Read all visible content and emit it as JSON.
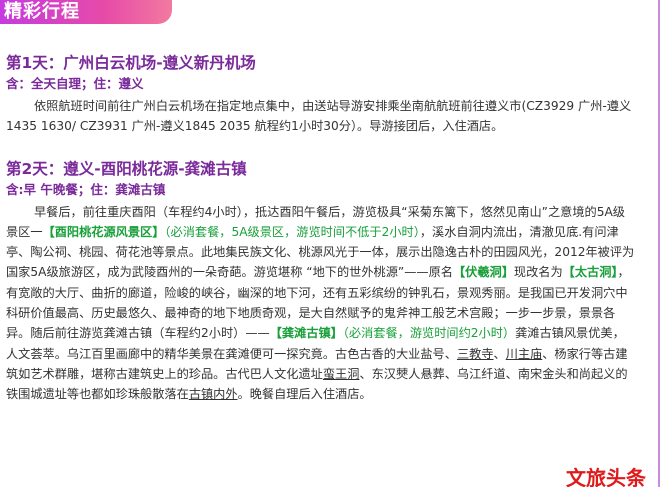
{
  "banner": {
    "title": "精彩行程"
  },
  "day1": {
    "title": "第1天：广州白云机场-遵义新丹机场",
    "meta": "含：全天自理；住：遵义",
    "text": "依照航班时间前往广州白云机场在指定地点集中，由送站导游安排乘坐南航航班前往遵义市(CZ3929 广州-遵义1435 1630/ CZ3931 广州-遵义1845 2035 航程约1小时30分）。导游接团后，入住酒店。"
  },
  "day2": {
    "title": "第2天：遵义-酉阳桃花源-龚滩古镇",
    "meta": "含:早 午晚餐；住：龚滩古镇",
    "t1": "早餐后，前往重庆酉阳（车程约4小时），抵达酉阳午餐后，游览极具“采菊东篱下，悠然见南山”之意境的5A级景区一",
    "h1": "【酉阳桃花源风景区】",
    "n1": "（必消套餐，5A级景区，游览时间不低于2小时）",
    "t2": "，溪水自洞内流出，清澈见底.有问津亭、陶公祠、桃园、荷花池等景点。此地集民族文化、桃源风光于一体，展示出隐逸古朴的田园风光，2012年被评为国家5A级旅游区，成为武陵酉州的一朵奇葩。游览堪称 “地下的世外桃源”——原名",
    "h2": "【伏羲洞】",
    "t3": "现改名为",
    "h3": "【太古洞】",
    "t4": "，有宽敞的大厅、曲折的廊道，险峻的峡谷，幽深的地下河，还有五彩缤纷的钟乳石，景观秀丽。是我国已开发洞穴中科研价值最高、历史最悠久、最神奇的地下地质奇观，是大自然赋予的鬼斧神工般艺术宫殿；一步一步景，景景各异。随后前往游览龚滩古镇（车程约2小时）——",
    "h4": "【龚滩古镇】",
    "n2": "（必消套餐，游览时间约2小时）",
    "t5": "龚滩古镇风景优美，人文荟萃。乌江百里画廊中的精华美景在龚滩便可一探究竟。古色古香的大业盐号、",
    "u1": "三教寺",
    "t6": "、",
    "u2": "川主庙",
    "t7": "、杨家行等古建筑如艺术群雕，堪称古建筑史上的珍品。古代巴人文化遗址",
    "u3": "蛮王洞",
    "t8": "、东汉僰人悬葬、乌江纤道、南宋金头和尚起义的铁围城遗址等也都如珍珠般散落在",
    "u4": "古镇内外",
    "t9": "。晚餐自理后入住酒店。"
  },
  "watermark": {
    "text": "文旅头条"
  },
  "colors": {
    "banner": "#d546c8",
    "title": "#7a2a9a",
    "highlight": "#19a03a",
    "watermark": "#e01a1a"
  }
}
